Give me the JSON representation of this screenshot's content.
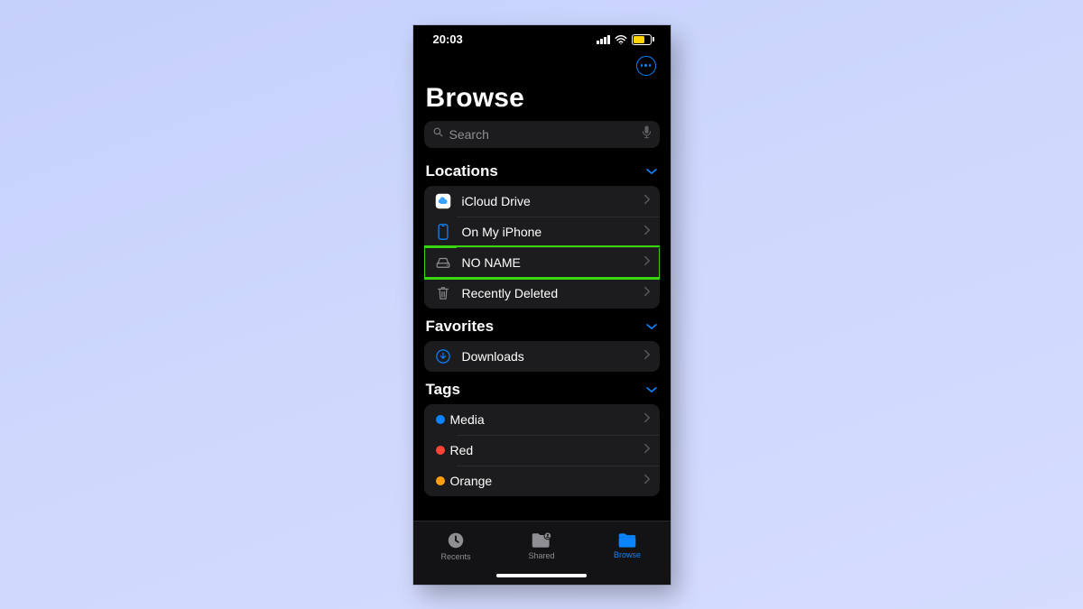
{
  "status": {
    "time": "20:03",
    "battery": "64"
  },
  "page_title": "Browse",
  "search": {
    "placeholder": "Search"
  },
  "sections": {
    "locations": {
      "title": "Locations",
      "items": [
        {
          "label": "iCloud Drive"
        },
        {
          "label": "On My iPhone"
        },
        {
          "label": "NO NAME"
        },
        {
          "label": "Recently Deleted"
        }
      ],
      "highlighted_index": 2
    },
    "favorites": {
      "title": "Favorites",
      "items": [
        {
          "label": "Downloads"
        }
      ]
    },
    "tags": {
      "title": "Tags",
      "items": [
        {
          "label": "Media",
          "color": "#0a84ff"
        },
        {
          "label": "Red",
          "color": "#ff453a"
        },
        {
          "label": "Orange",
          "color": "#ff9f0a"
        }
      ]
    }
  },
  "tabs": [
    {
      "label": "Recents"
    },
    {
      "label": "Shared"
    },
    {
      "label": "Browse"
    }
  ],
  "active_tab": 2,
  "colors": {
    "accent": "#0a84ff"
  }
}
